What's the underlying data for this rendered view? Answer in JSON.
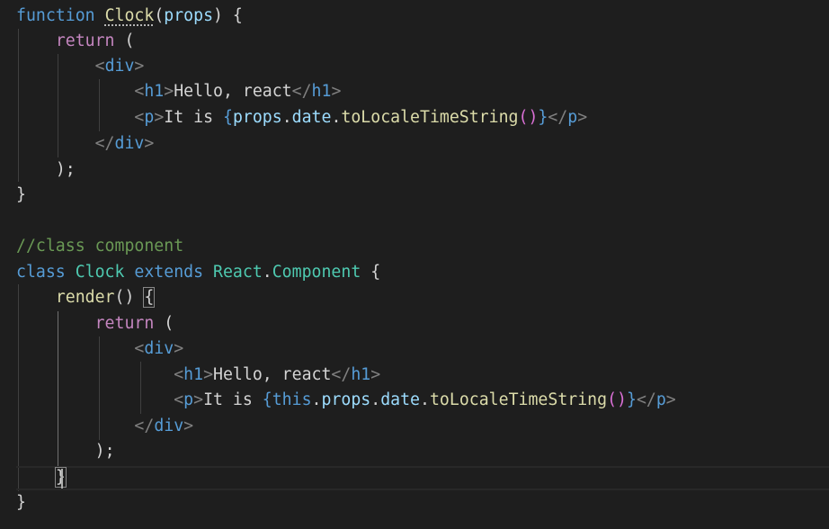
{
  "editor": {
    "theme_colors": {
      "background": "#1e1e1e",
      "keyword": "#569cd6",
      "control": "#c586c0",
      "function": "#dcdcaa",
      "class": "#4ec9b0",
      "variable": "#9cdcfe",
      "text": "#d4d4d4",
      "tag_bracket": "#808080",
      "comment": "#6a9955"
    },
    "cursor_line": 19,
    "lines": [
      "function Clock(props) {",
      "    return (",
      "        <div>",
      "            <h1>Hello, react</h1>",
      "            <p>It is {props.date.toLocaleTimeString()}</p>",
      "        </div>",
      "    );",
      "}",
      "",
      "//class component",
      "class Clock extends React.Component {",
      "    render() {",
      "        return (",
      "            <div>",
      "                <h1>Hello, react</h1>",
      "                <p>It is {this.props.date.toLocaleTimeString()}</p>",
      "            </div>",
      "        );",
      "    }",
      "}"
    ]
  }
}
